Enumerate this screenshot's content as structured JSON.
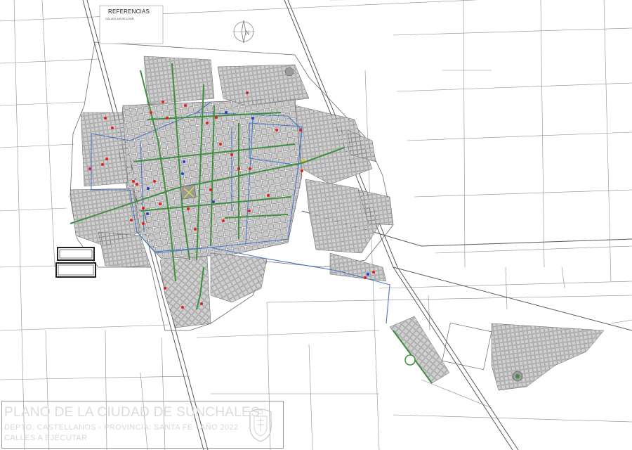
{
  "legend": {
    "title": "REFERENCIAS",
    "subtitle": "CALLES A EJECUTAR"
  },
  "title_block": {
    "main": "PLANO DE LA CIUDAD DE SUNCHALES",
    "line2": "DEPTO. CASTELLANOS  -  PROVINCIA: SANTA FE  -  AÑO 2022",
    "line3": "CALLES A EJECUTAR"
  },
  "compass": {
    "label": "N"
  },
  "colors": {
    "streets_to_build": "#3f8f3f",
    "boundary": "#4a78c4",
    "block_fill": "#c7c7c7",
    "block_stroke": "#6b6b6b",
    "marker_red": "#e02020",
    "marker_blue": "#2040d0",
    "plaza": "#8a8a8a"
  },
  "icons": [
    "compass-icon",
    "seal-icon"
  ]
}
